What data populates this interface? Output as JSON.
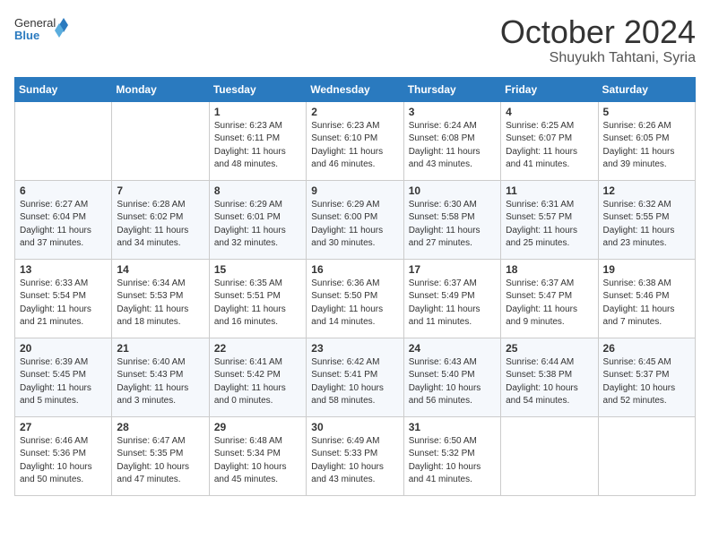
{
  "header": {
    "logo": {
      "general": "General",
      "blue": "Blue"
    },
    "month": "October 2024",
    "location": "Shuyukh Tahtani, Syria"
  },
  "weekdays": [
    "Sunday",
    "Monday",
    "Tuesday",
    "Wednesday",
    "Thursday",
    "Friday",
    "Saturday"
  ],
  "weeks": [
    [
      {
        "day": "",
        "info": ""
      },
      {
        "day": "",
        "info": ""
      },
      {
        "day": "1",
        "info": "Sunrise: 6:23 AM\nSunset: 6:11 PM\nDaylight: 11 hours and 48 minutes."
      },
      {
        "day": "2",
        "info": "Sunrise: 6:23 AM\nSunset: 6:10 PM\nDaylight: 11 hours and 46 minutes."
      },
      {
        "day": "3",
        "info": "Sunrise: 6:24 AM\nSunset: 6:08 PM\nDaylight: 11 hours and 43 minutes."
      },
      {
        "day": "4",
        "info": "Sunrise: 6:25 AM\nSunset: 6:07 PM\nDaylight: 11 hours and 41 minutes."
      },
      {
        "day": "5",
        "info": "Sunrise: 6:26 AM\nSunset: 6:05 PM\nDaylight: 11 hours and 39 minutes."
      }
    ],
    [
      {
        "day": "6",
        "info": "Sunrise: 6:27 AM\nSunset: 6:04 PM\nDaylight: 11 hours and 37 minutes."
      },
      {
        "day": "7",
        "info": "Sunrise: 6:28 AM\nSunset: 6:02 PM\nDaylight: 11 hours and 34 minutes."
      },
      {
        "day": "8",
        "info": "Sunrise: 6:29 AM\nSunset: 6:01 PM\nDaylight: 11 hours and 32 minutes."
      },
      {
        "day": "9",
        "info": "Sunrise: 6:29 AM\nSunset: 6:00 PM\nDaylight: 11 hours and 30 minutes."
      },
      {
        "day": "10",
        "info": "Sunrise: 6:30 AM\nSunset: 5:58 PM\nDaylight: 11 hours and 27 minutes."
      },
      {
        "day": "11",
        "info": "Sunrise: 6:31 AM\nSunset: 5:57 PM\nDaylight: 11 hours and 25 minutes."
      },
      {
        "day": "12",
        "info": "Sunrise: 6:32 AM\nSunset: 5:55 PM\nDaylight: 11 hours and 23 minutes."
      }
    ],
    [
      {
        "day": "13",
        "info": "Sunrise: 6:33 AM\nSunset: 5:54 PM\nDaylight: 11 hours and 21 minutes."
      },
      {
        "day": "14",
        "info": "Sunrise: 6:34 AM\nSunset: 5:53 PM\nDaylight: 11 hours and 18 minutes."
      },
      {
        "day": "15",
        "info": "Sunrise: 6:35 AM\nSunset: 5:51 PM\nDaylight: 11 hours and 16 minutes."
      },
      {
        "day": "16",
        "info": "Sunrise: 6:36 AM\nSunset: 5:50 PM\nDaylight: 11 hours and 14 minutes."
      },
      {
        "day": "17",
        "info": "Sunrise: 6:37 AM\nSunset: 5:49 PM\nDaylight: 11 hours and 11 minutes."
      },
      {
        "day": "18",
        "info": "Sunrise: 6:37 AM\nSunset: 5:47 PM\nDaylight: 11 hours and 9 minutes."
      },
      {
        "day": "19",
        "info": "Sunrise: 6:38 AM\nSunset: 5:46 PM\nDaylight: 11 hours and 7 minutes."
      }
    ],
    [
      {
        "day": "20",
        "info": "Sunrise: 6:39 AM\nSunset: 5:45 PM\nDaylight: 11 hours and 5 minutes."
      },
      {
        "day": "21",
        "info": "Sunrise: 6:40 AM\nSunset: 5:43 PM\nDaylight: 11 hours and 3 minutes."
      },
      {
        "day": "22",
        "info": "Sunrise: 6:41 AM\nSunset: 5:42 PM\nDaylight: 11 hours and 0 minutes."
      },
      {
        "day": "23",
        "info": "Sunrise: 6:42 AM\nSunset: 5:41 PM\nDaylight: 10 hours and 58 minutes."
      },
      {
        "day": "24",
        "info": "Sunrise: 6:43 AM\nSunset: 5:40 PM\nDaylight: 10 hours and 56 minutes."
      },
      {
        "day": "25",
        "info": "Sunrise: 6:44 AM\nSunset: 5:38 PM\nDaylight: 10 hours and 54 minutes."
      },
      {
        "day": "26",
        "info": "Sunrise: 6:45 AM\nSunset: 5:37 PM\nDaylight: 10 hours and 52 minutes."
      }
    ],
    [
      {
        "day": "27",
        "info": "Sunrise: 6:46 AM\nSunset: 5:36 PM\nDaylight: 10 hours and 50 minutes."
      },
      {
        "day": "28",
        "info": "Sunrise: 6:47 AM\nSunset: 5:35 PM\nDaylight: 10 hours and 47 minutes."
      },
      {
        "day": "29",
        "info": "Sunrise: 6:48 AM\nSunset: 5:34 PM\nDaylight: 10 hours and 45 minutes."
      },
      {
        "day": "30",
        "info": "Sunrise: 6:49 AM\nSunset: 5:33 PM\nDaylight: 10 hours and 43 minutes."
      },
      {
        "day": "31",
        "info": "Sunrise: 6:50 AM\nSunset: 5:32 PM\nDaylight: 10 hours and 41 minutes."
      },
      {
        "day": "",
        "info": ""
      },
      {
        "day": "",
        "info": ""
      }
    ]
  ]
}
